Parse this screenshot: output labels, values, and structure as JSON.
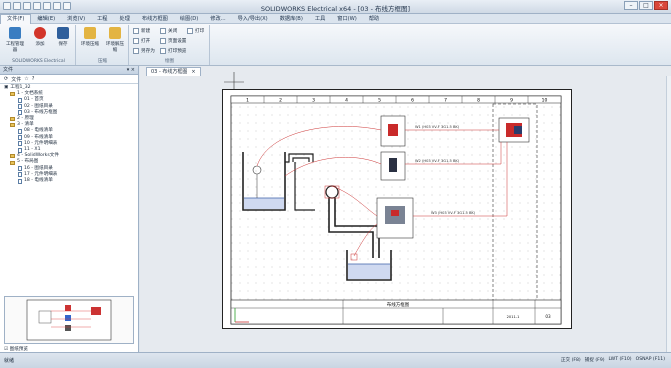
{
  "titlebar": {
    "title": "SOLIDWORKS Electrical x64 - [03 - 布线方框图]"
  },
  "menu": [
    "文件(F)",
    "编辑(E)",
    "浏览(V)",
    "工程",
    "处理",
    "布线方框图",
    "绘图(D)",
    "修改...",
    "导入/导出(X)",
    "数据库(B)",
    "工具",
    "窗口(W)",
    "帮助"
  ],
  "ribbon": {
    "group1_label": "SOLIDWORKS Electrical",
    "project_manager": "工程管理器",
    "add": "添加",
    "save": "保存",
    "group2_label": "压缩",
    "compress": "环境压缩",
    "decompress": "环境解压缩",
    "group3_label": "绘图",
    "new": "新建",
    "close": "关闭",
    "print": "打印",
    "open": "打开",
    "page_setup": "页面设置",
    "save_as": "另存为",
    "print_preview": "打印预览"
  },
  "leftpanel": {
    "header": "文件",
    "toolbar_label": "文件",
    "tree": [
      {
        "label": "工程1_32",
        "type": "root"
      },
      {
        "label": "1 - 文档系统",
        "type": "folder"
      },
      {
        "label": "01 - 首页",
        "type": "page"
      },
      {
        "label": "02 - 图纸目录",
        "type": "page"
      },
      {
        "label": "03 - 布线方框图",
        "type": "page"
      },
      {
        "label": "2 - 原理",
        "type": "folder"
      },
      {
        "label": "3 - 清单",
        "type": "folder"
      },
      {
        "label": "08 - 电线清单",
        "type": "page"
      },
      {
        "label": "09 - 布线清单",
        "type": "page"
      },
      {
        "label": "10 - 元件明细表",
        "type": "page"
      },
      {
        "label": "11 - X1",
        "type": "page"
      },
      {
        "label": "4 - SolidWorks文件",
        "type": "folder"
      },
      {
        "label": "5 - 布局图",
        "type": "folder"
      },
      {
        "label": "16 - 图纸目录",
        "type": "page"
      },
      {
        "label": "17 - 元件明细表",
        "type": "page"
      },
      {
        "label": "18 - 电线清单",
        "type": "page"
      }
    ],
    "preview_label": "图纸预览"
  },
  "document": {
    "tab": "03 - 布线方框图",
    "frame_columns": [
      "1",
      "2",
      "3",
      "4",
      "5",
      "6",
      "7",
      "8",
      "9",
      "10"
    ],
    "sheet_title": "布线方框图",
    "cable_labels": [
      "W1 (H03 VV-F 3G1.5 BK)",
      "W2 (H03 VV-F 3G1.5 BK)",
      "W3 (H03 VV-F 3G1.5 BK)"
    ],
    "sheet_number": "03",
    "revision": "2011-1"
  },
  "statusbar": {
    "left": "就绪",
    "right": [
      "正交 (F8)",
      "捕捉 (F9)",
      "LWT (F10)",
      "OSNAP (F11)"
    ]
  }
}
